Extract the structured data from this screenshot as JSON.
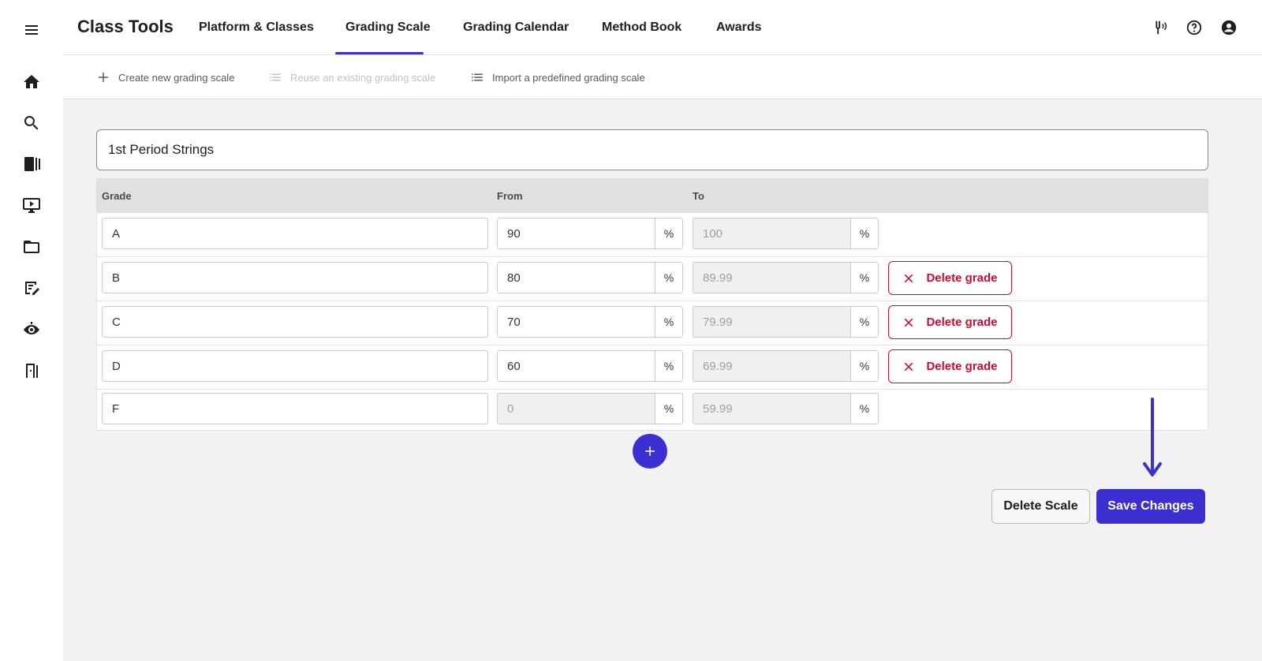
{
  "app": {
    "title": "Class Tools"
  },
  "nav": {
    "tabs": [
      {
        "label": "Platform & Classes",
        "active": false
      },
      {
        "label": "Grading Scale",
        "active": true
      },
      {
        "label": "Grading Calendar",
        "active": false
      },
      {
        "label": "Method Book",
        "active": false
      },
      {
        "label": "Awards",
        "active": false
      }
    ],
    "icons": [
      "tuning-fork-icon",
      "help-icon",
      "account-icon"
    ]
  },
  "rail": {
    "icons": [
      "menu-icon",
      "home-icon",
      "search-icon",
      "library-icon",
      "video-icon",
      "folder-icon",
      "assignment-icon",
      "observe-icon",
      "exit-icon"
    ]
  },
  "subtoolbar": {
    "actions": [
      {
        "label": "Create new grading scale",
        "icon": "plus-icon",
        "disabled": false
      },
      {
        "label": "Reuse an existing grading scale",
        "icon": "list-icon",
        "disabled": true
      },
      {
        "label": "Import a predefined grading scale",
        "icon": "list-icon",
        "disabled": false
      }
    ]
  },
  "scale": {
    "name": "1st Period Strings",
    "columns": {
      "grade": "Grade",
      "from": "From",
      "to": "To"
    },
    "percent_symbol": "%",
    "rows": [
      {
        "grade": "A",
        "from": "90",
        "to": "100",
        "from_readonly": false,
        "deletable": false
      },
      {
        "grade": "B",
        "from": "80",
        "to": "89.99",
        "from_readonly": false,
        "deletable": true
      },
      {
        "grade": "C",
        "from": "70",
        "to": "79.99",
        "from_readonly": false,
        "deletable": true
      },
      {
        "grade": "D",
        "from": "60",
        "to": "69.99",
        "from_readonly": false,
        "deletable": true
      },
      {
        "grade": "F",
        "from": "0",
        "to": "59.99",
        "from_readonly": true,
        "deletable": false
      }
    ],
    "delete_grade_label": "Delete grade"
  },
  "actions": {
    "delete_scale_label": "Delete Scale",
    "save_changes_label": "Save Changes"
  },
  "colors": {
    "accent": "#3c2fd1",
    "danger": "#c8102e",
    "content_bg": "#f2f2f2"
  }
}
